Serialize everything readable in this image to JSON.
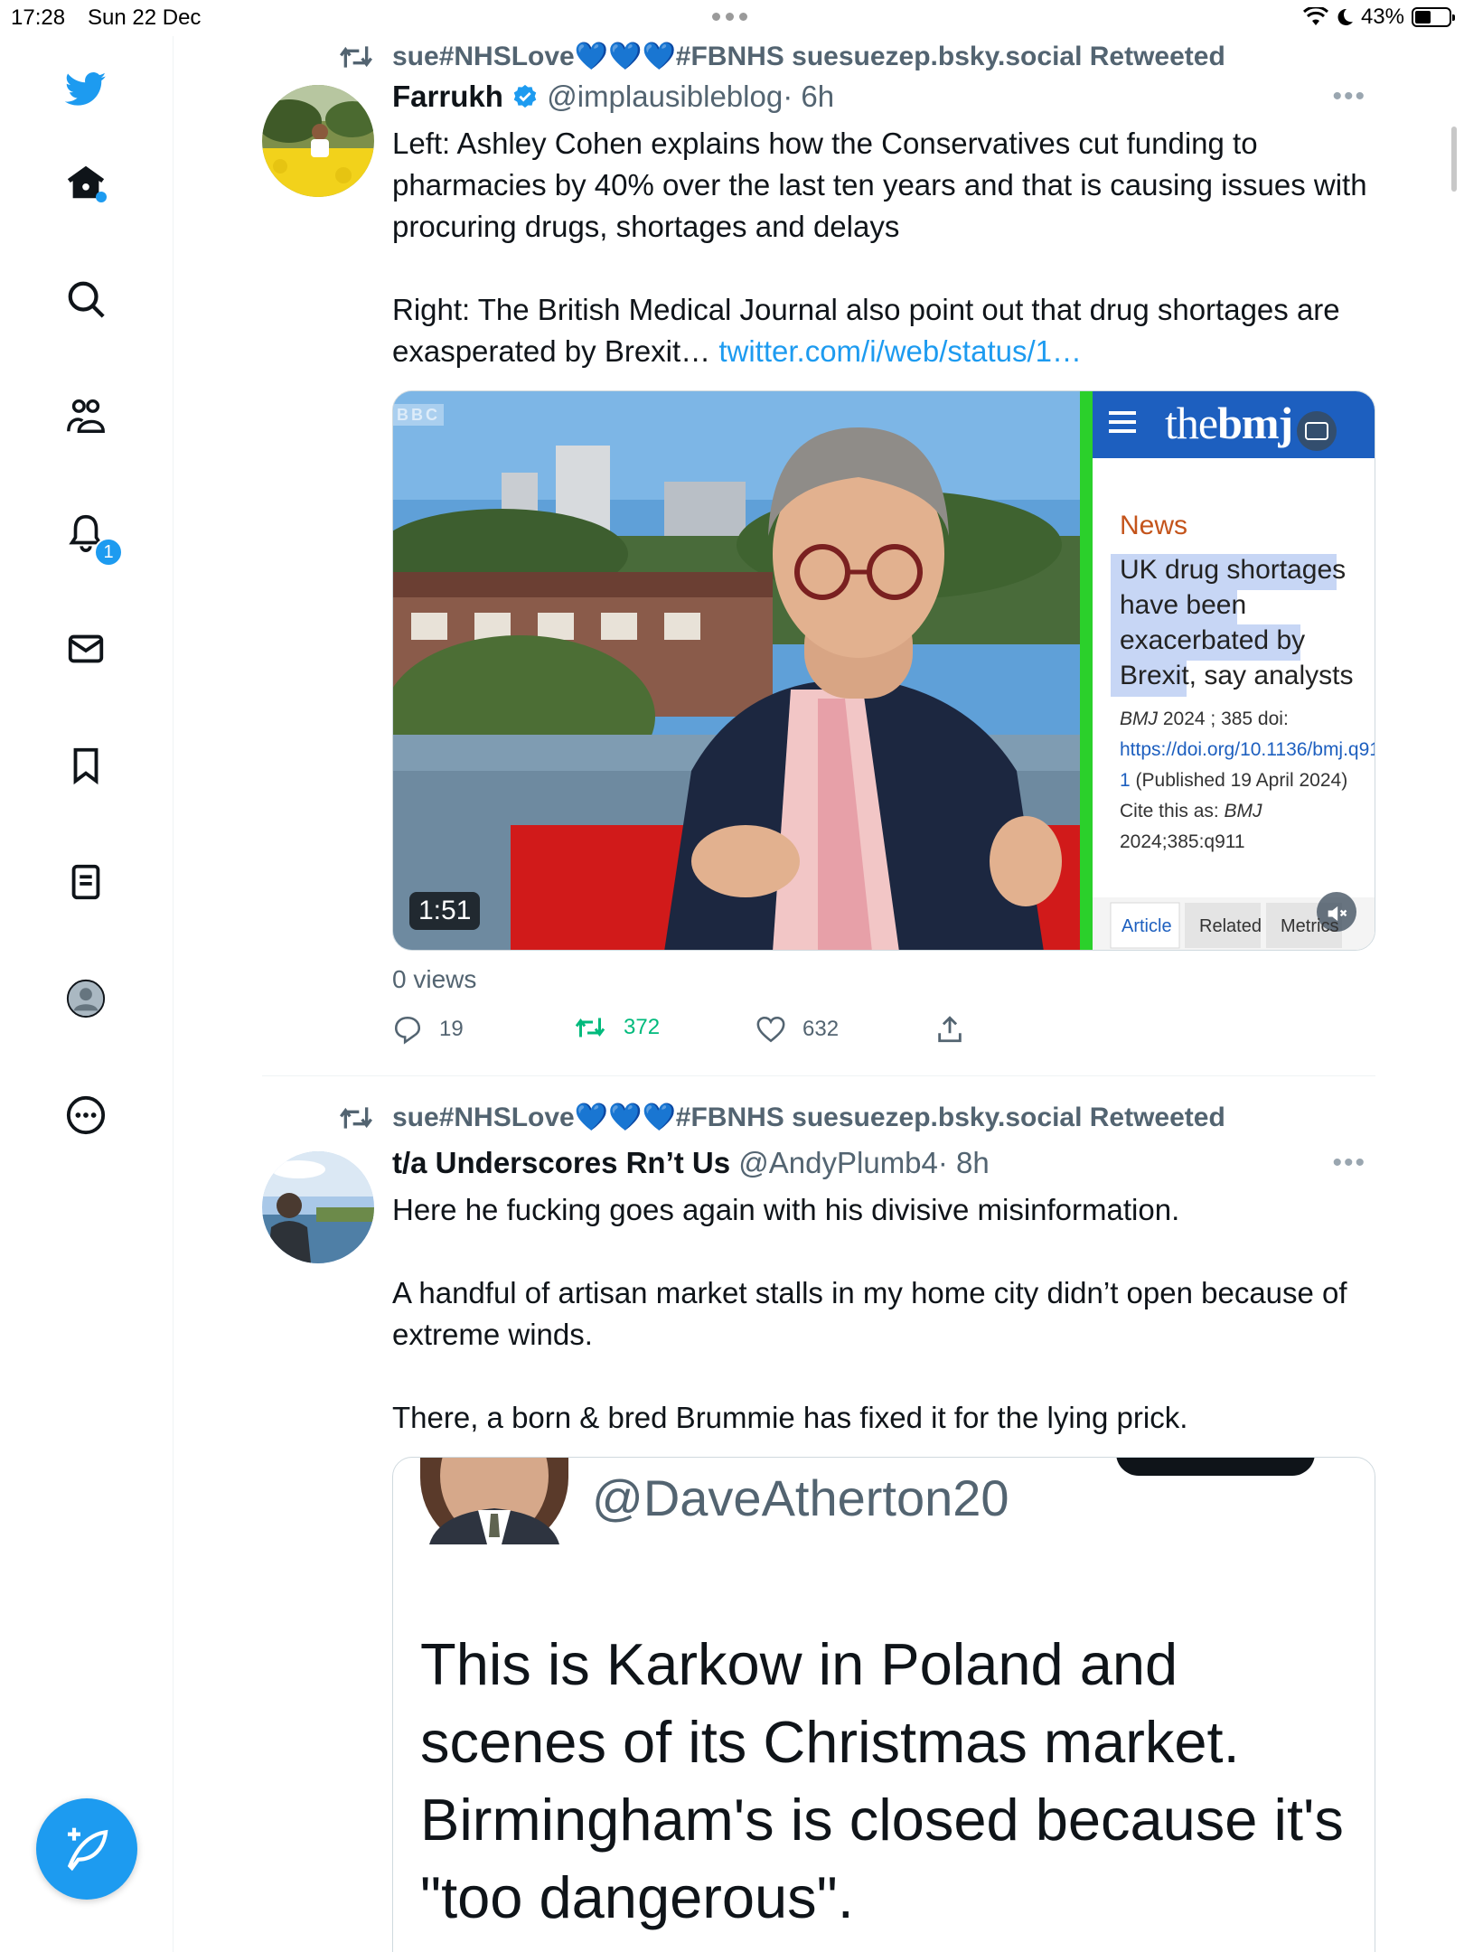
{
  "status_bar": {
    "time": "17:28",
    "date": "Sun 22 Dec",
    "battery": "43%"
  },
  "sidebar": {
    "items": [
      "twitter-logo",
      "home",
      "search",
      "communities",
      "notifications",
      "messages",
      "bookmarks",
      "lists",
      "profile",
      "more"
    ],
    "notifications_badge": "1"
  },
  "tweets": [
    {
      "retweet_label": "sue#NHSLove💙💙💙#FBNHS suesuezep.bsky.social Retweeted",
      "name": "Farrukh",
      "verified": true,
      "handle": "@implausibleblog",
      "time": "· 6h",
      "text_p1": "Left: Ashley Cohen explains how the Conservatives cut funding to pharmacies by 40% over the last ten years and that is causing issues with procuring drugs, shortages and delays",
      "text_p2": "Right: The British Medical Journal also point out that drug shortages are exasperated by Brexit…",
      "link": "twitter.com/i/web/status/1…",
      "media": {
        "duration": "1:51",
        "bbc_logo": "BBC",
        "bmj_logo_the": "the",
        "bmj_logo_bmj": "bmj",
        "bmj_section": "News",
        "bmj_headline_highlighted": "UK drug shortages have been exacerbated by Brexit,",
        "bmj_headline_rest": " say analysts",
        "bmj_cite_1": "BMJ",
        "bmj_cite_2": "2024 ; 385  doi:",
        "bmj_doi": "https://doi.org/10.1136/bmj.q911",
        "bmj_published": "(Published 19 April 2024)",
        "bmj_cite_as": "Cite this as: ",
        "bmj_cite_journal": "BMJ",
        "bmj_cite_ref": "2024;385:q911",
        "bmj_tabs": [
          "Article",
          "Related",
          "Metrics"
        ]
      },
      "views": "0 views",
      "replies": "19",
      "retweets": "372",
      "likes": "632"
    },
    {
      "retweet_label": "sue#NHSLove💙💙💙#FBNHS suesuezep.bsky.social Retweeted",
      "name": "t/a Underscores Rn’t Us",
      "handle": "@AndyPlumb4",
      "time": "· 8h",
      "text_p1": "Here he fucking goes again with his divisive misinformation.",
      "text_p2": "A handful of artisan market stalls in my home city didn’t open because of extreme winds.",
      "text_p3": "There, a born & bred Brummie has fixed it for the lying prick.",
      "quoted": {
        "handle": "@DaveAtherton20",
        "text": "This is Karkow in Poland and scenes of its Christmas market. Birmingham's is closed because it's \"too dangerous\"."
      }
    }
  ],
  "colors": {
    "accent": "#1d9bf0",
    "retweet_green": "#00ba7c",
    "muted": "#536471"
  }
}
